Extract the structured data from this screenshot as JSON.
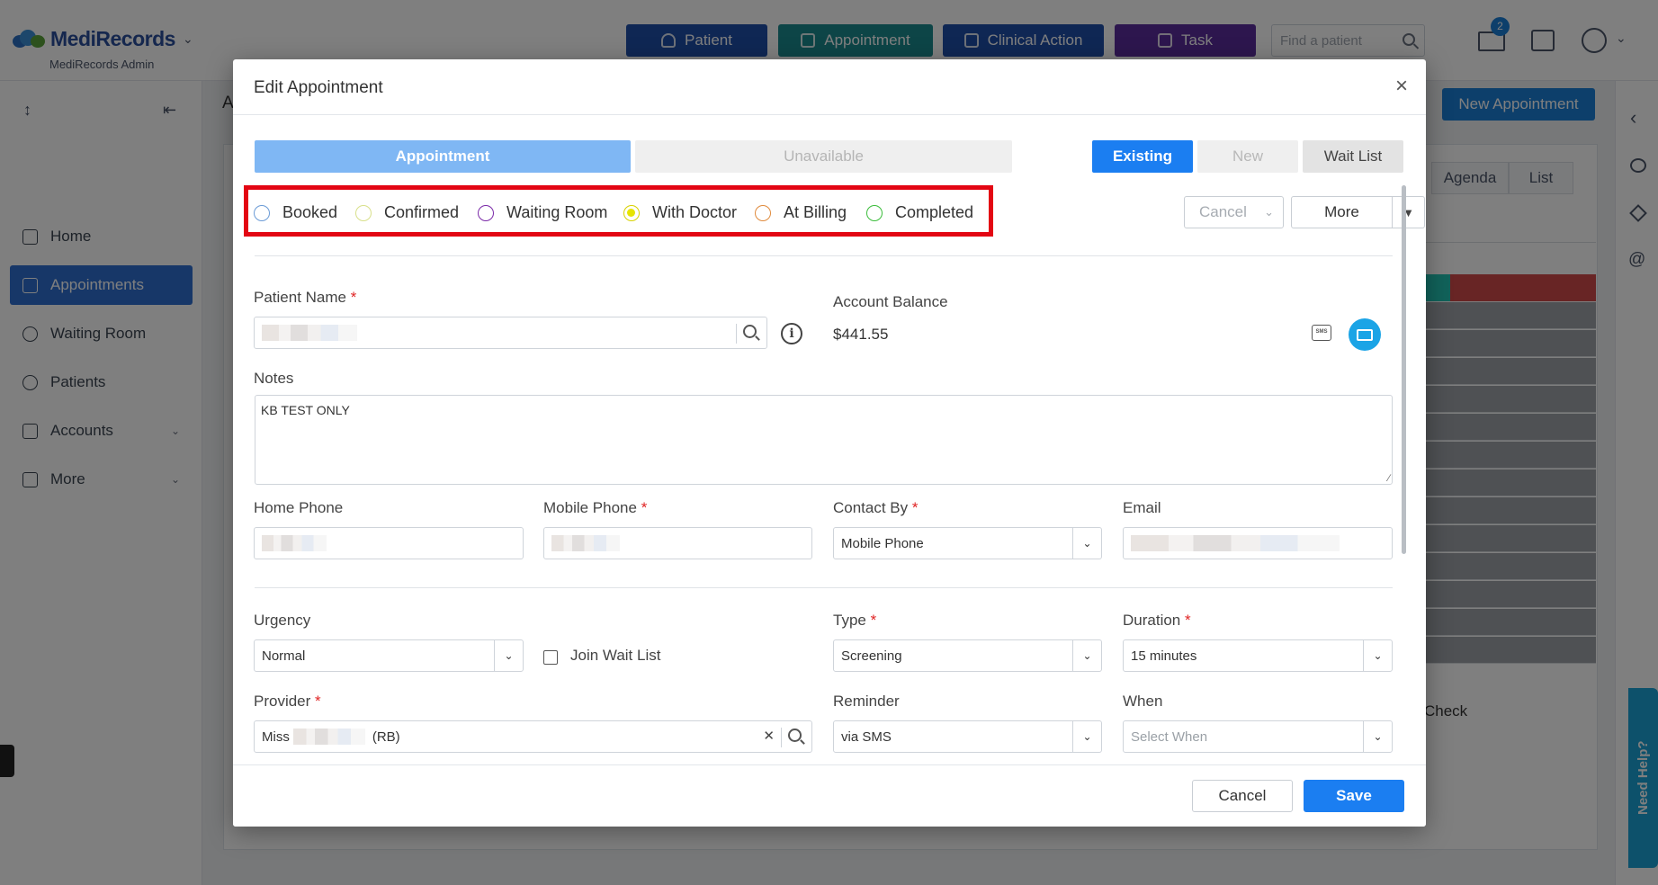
{
  "app": {
    "logo_text": "MediRecords",
    "admin_label": "MediRecords Admin",
    "mail_badge": "2"
  },
  "topnav": {
    "patient": "Patient",
    "appointment": "Appointment",
    "clinical_action": "Clinical Action",
    "task": "Task",
    "search_placeholder": "Find a patient"
  },
  "colors": {
    "patient": "#1f4fa8",
    "appointment": "#1b8a8f",
    "clinical_action": "#1f4fa8",
    "task": "#5a2d9c"
  },
  "sidebar": {
    "items": [
      {
        "label": "Home",
        "icon": "home-icon"
      },
      {
        "label": "Appointments",
        "icon": "calendar-icon"
      },
      {
        "label": "Waiting Room",
        "icon": "users-icon"
      },
      {
        "label": "Patients",
        "icon": "user-group-icon"
      },
      {
        "label": "Accounts",
        "icon": "folder-icon"
      },
      {
        "label": "More",
        "icon": "export-icon"
      }
    ]
  },
  "background": {
    "new_appointment": "New Appointment",
    "tab_agenda": "Agenda",
    "tab_list": "List",
    "partial_check": "Check",
    "partial_a": "A",
    "need_help": "Need Help?"
  },
  "modal": {
    "title": "Edit Appointment",
    "tab_appointment": "Appointment",
    "tab_unavailable": "Unavailable",
    "btn_existing": "Existing",
    "btn_new": "New",
    "btn_wait_list": "Wait List",
    "statuses": [
      {
        "label": "Booked",
        "color": "#6b9bd6",
        "selected": false
      },
      {
        "label": "Confirmed",
        "color": "#d8e08a",
        "selected": false
      },
      {
        "label": "Waiting Room",
        "color": "#7b2aa8",
        "selected": false
      },
      {
        "label": "With Doctor",
        "color": "#d8d200",
        "selected": true
      },
      {
        "label": "At Billing",
        "color": "#e08a3c",
        "selected": false
      },
      {
        "label": "Completed",
        "color": "#3bbd3b",
        "selected": false
      }
    ],
    "cancel_dropdown": "Cancel",
    "more_button": "More",
    "patient_name_label": "Patient Name",
    "account_balance_label": "Account Balance",
    "account_balance_value": "$441.55",
    "sms_icon_text": "SMS",
    "notes_label": "Notes",
    "notes_value": "KB TEST ONLY",
    "home_phone_label": "Home Phone",
    "mobile_phone_label": "Mobile Phone",
    "contact_by_label": "Contact By",
    "contact_by_value": "Mobile Phone",
    "email_label": "Email",
    "urgency_label": "Urgency",
    "urgency_value": "Normal",
    "join_wait_list_label": "Join Wait List",
    "type_label": "Type",
    "type_value": "Screening",
    "duration_label": "Duration",
    "duration_value": "15 minutes",
    "provider_label": "Provider",
    "provider_prefix": "Miss",
    "provider_suffix": "(RB)",
    "reminder_label": "Reminder",
    "reminder_value": "via SMS",
    "when_label": "When",
    "when_placeholder": "Select When",
    "footer_cancel": "Cancel",
    "footer_save": "Save",
    "required_mark": "*"
  }
}
